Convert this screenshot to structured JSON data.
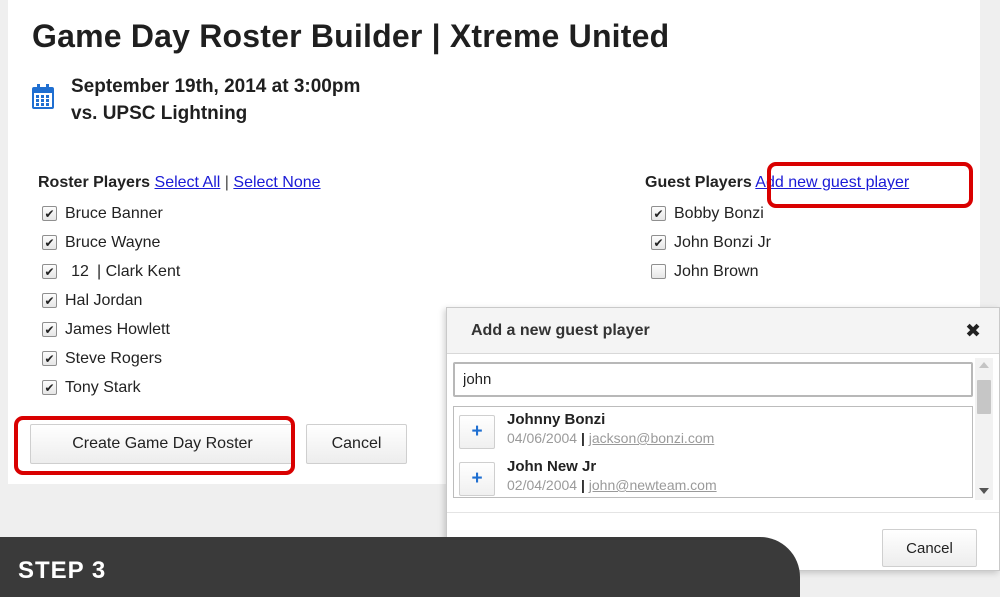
{
  "page": {
    "title": "Game Day Roster Builder | Xtreme United",
    "event_date": "September 19th, 2014 at 3:00pm",
    "event_opponent": "vs. UPSC Lightning",
    "calendar_icon": "calendar-icon"
  },
  "roster": {
    "heading": "Roster Players",
    "select_all": "Select All",
    "separator": "|",
    "select_none": "Select None",
    "players": [
      {
        "name": "Bruce Banner",
        "checked": true,
        "number": ""
      },
      {
        "name": "Bruce Wayne",
        "checked": true,
        "number": ""
      },
      {
        "name": "| Clark Kent",
        "checked": true,
        "number": "12"
      },
      {
        "name": "Hal Jordan",
        "checked": true,
        "number": ""
      },
      {
        "name": "James Howlett",
        "checked": true,
        "number": ""
      },
      {
        "name": "Steve Rogers",
        "checked": true,
        "number": ""
      },
      {
        "name": "Tony Stark",
        "checked": true,
        "number": ""
      }
    ]
  },
  "guests": {
    "heading": "Guest Players",
    "add_link": "Add new guest player",
    "players": [
      {
        "name": "Bobby Bonzi",
        "checked": true
      },
      {
        "name": "John Bonzi Jr",
        "checked": true
      },
      {
        "name": "John Brown",
        "checked": false
      }
    ]
  },
  "actions": {
    "create_label": "Create Game Day Roster",
    "cancel_label": "Cancel"
  },
  "modal": {
    "title": "Add a new guest player",
    "close_glyph": "✖",
    "search_value": "john",
    "results": [
      {
        "add_glyph": "+",
        "name": "Johnny Bonzi",
        "dob": "04/06/2004",
        "pipe": "|",
        "email": "jackson@bonzi.com"
      },
      {
        "add_glyph": "+",
        "name": "John New Jr",
        "dob": "02/04/2004",
        "pipe": "|",
        "email": "john@newteam.com"
      }
    ],
    "cancel_label": "Cancel"
  },
  "banner": {
    "step_label": "STEP 3"
  },
  "colors": {
    "highlight": "#d90000",
    "link": "#1a1ad6",
    "calendar": "#1f6fd1",
    "banner": "#3a3a3a"
  }
}
